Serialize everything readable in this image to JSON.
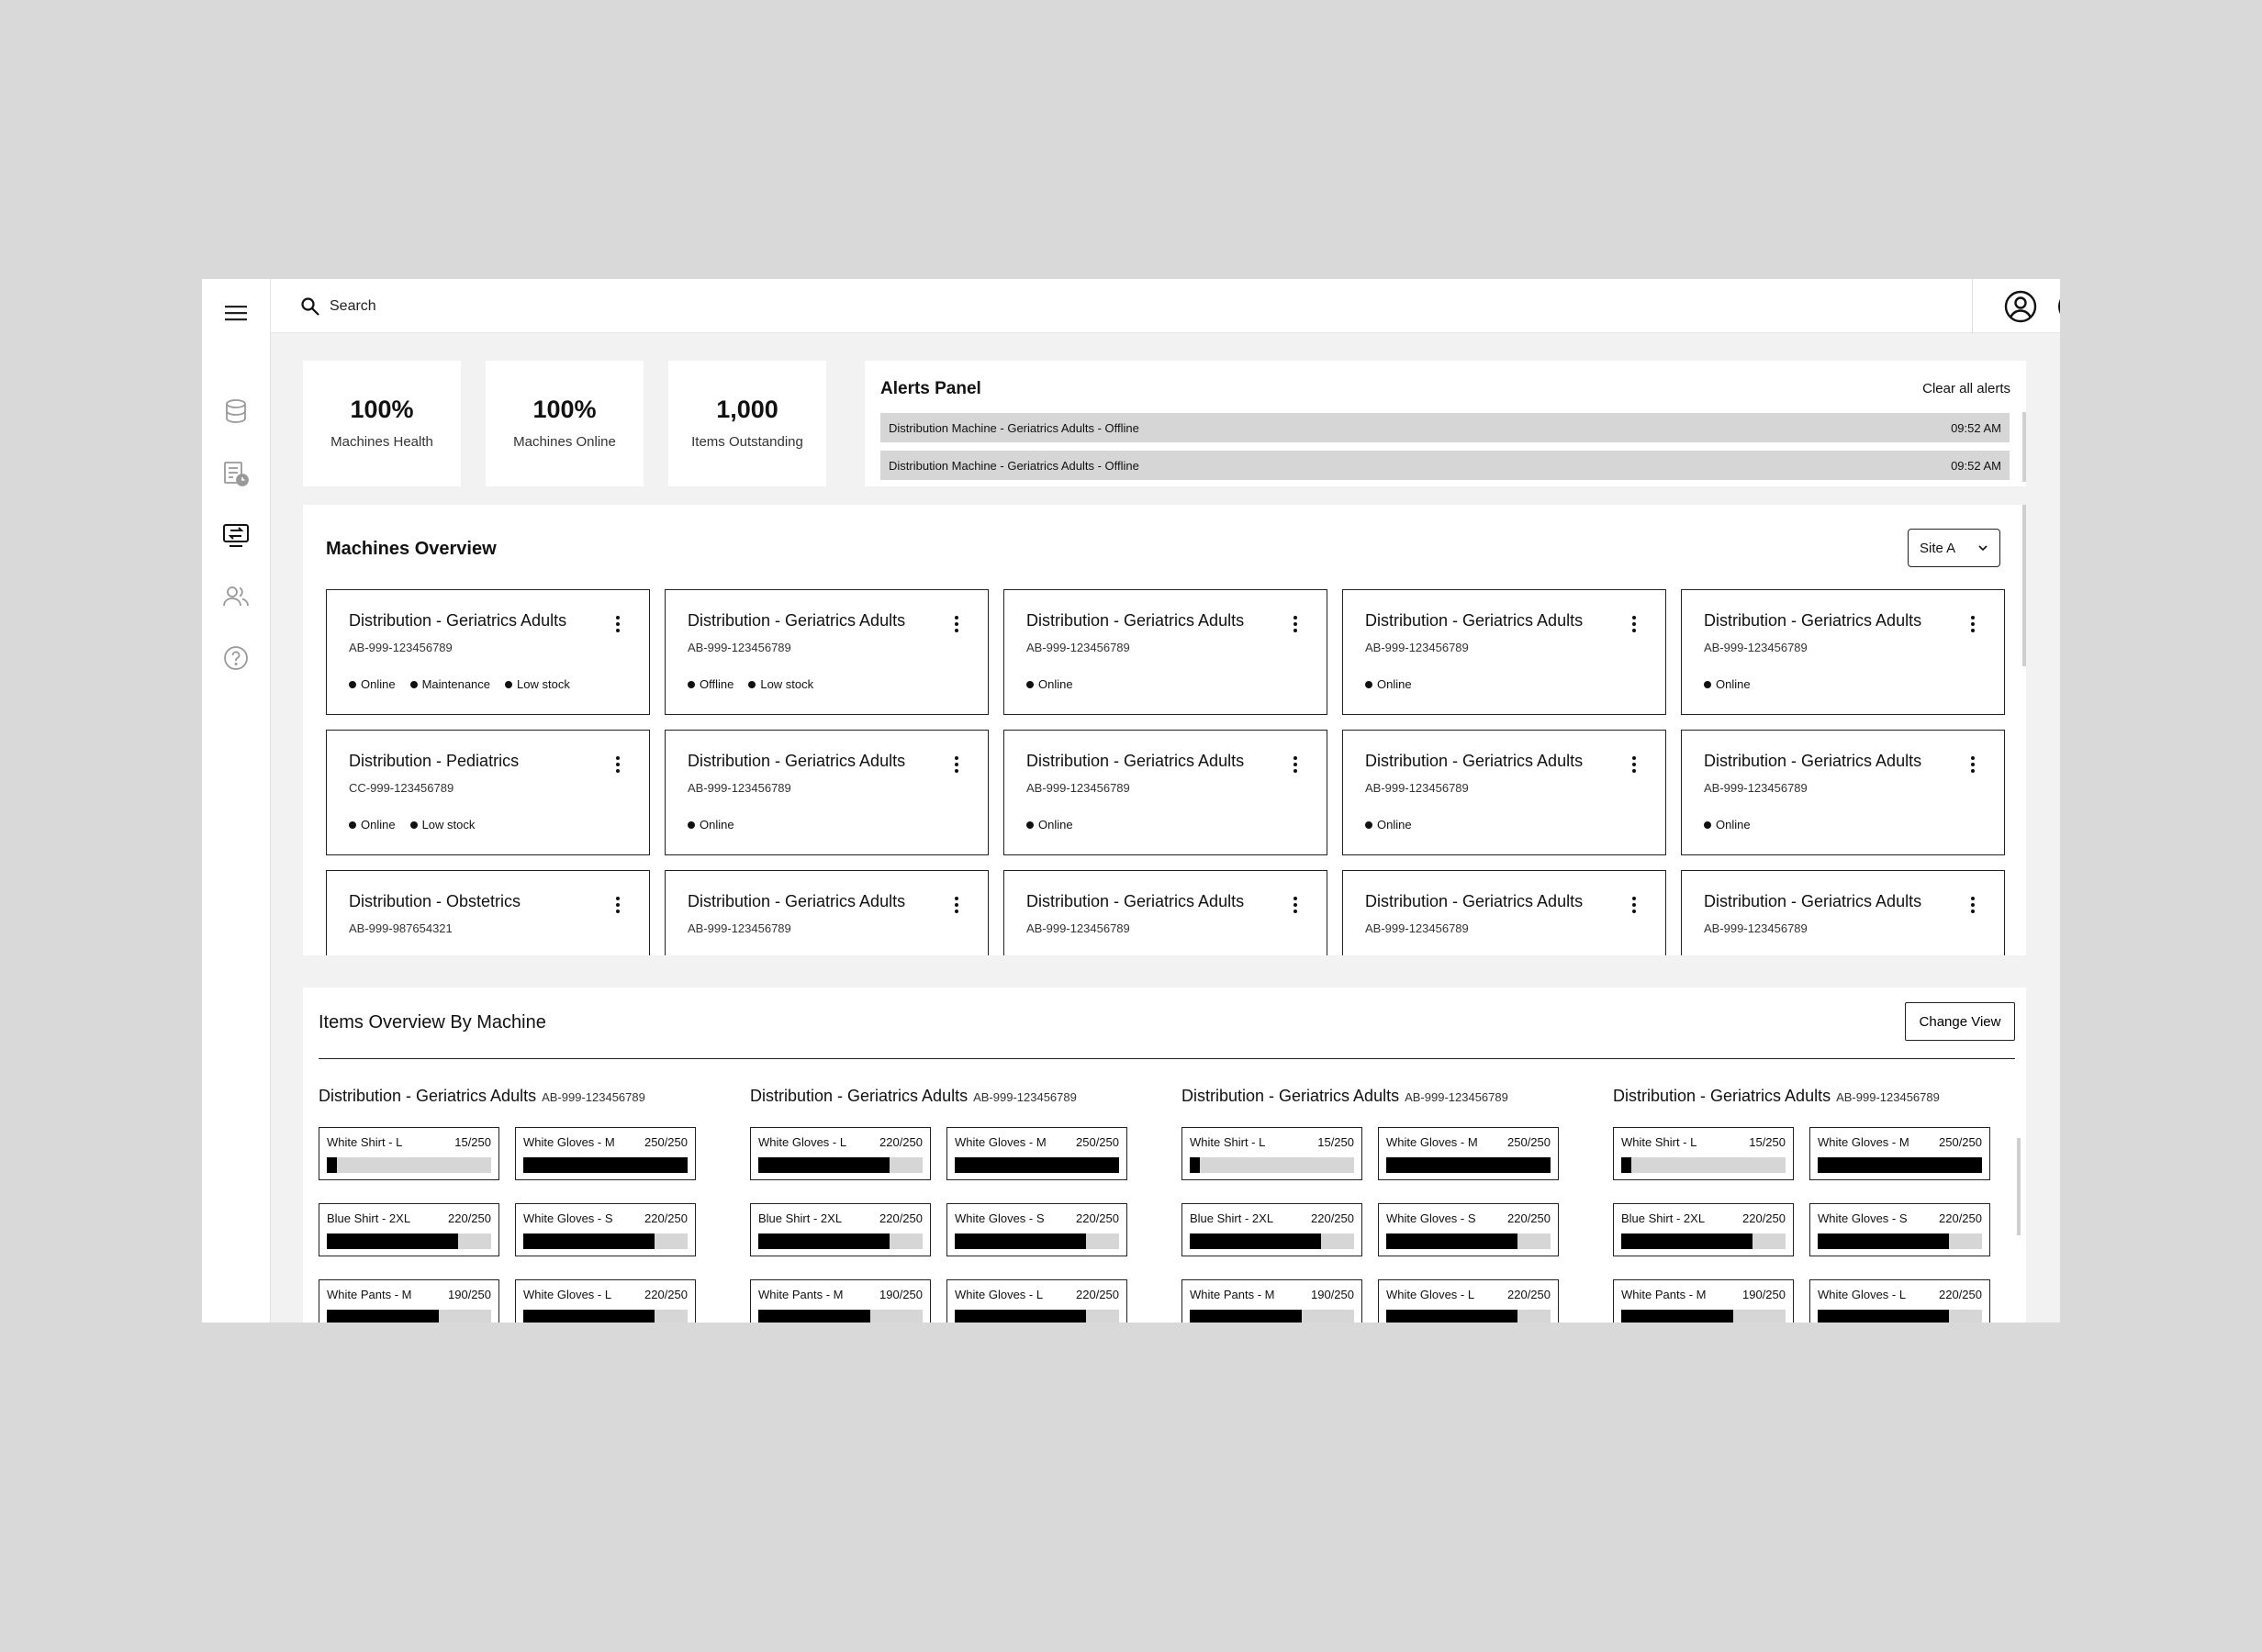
{
  "search": {
    "placeholder": "Search"
  },
  "stats": [
    {
      "value": "100%",
      "label": "Machines Health"
    },
    {
      "value": "100%",
      "label": "Machines Online"
    },
    {
      "value": "1,000",
      "label": "Items Outstanding"
    }
  ],
  "alerts": {
    "title": "Alerts Panel",
    "clear_label": "Clear all alerts",
    "rows": [
      {
        "text": "Distribution Machine  - Geriatrics Adults - Offline",
        "time": "09:52 AM"
      },
      {
        "text": "Distribution Machine  - Geriatrics Adults - Offline",
        "time": "09:52 AM"
      }
    ]
  },
  "machines": {
    "title": "Machines Overview",
    "site_select": "Site A",
    "cards": [
      {
        "name": "Distribution - Geriatrics Adults",
        "code": "AB-999-123456789",
        "statuses": [
          "Online",
          "Maintenance",
          "Low stock"
        ]
      },
      {
        "name": "Distribution - Geriatrics Adults",
        "code": "AB-999-123456789",
        "statuses": [
          "Offline",
          "Low stock"
        ]
      },
      {
        "name": "Distribution - Geriatrics Adults",
        "code": "AB-999-123456789",
        "statuses": [
          "Online"
        ]
      },
      {
        "name": "Distribution - Geriatrics Adults",
        "code": "AB-999-123456789",
        "statuses": [
          "Online"
        ]
      },
      {
        "name": "Distribution - Geriatrics Adults",
        "code": "AB-999-123456789",
        "statuses": [
          "Online"
        ]
      },
      {
        "name": "Distribution - Pediatrics",
        "code": "CC-999-123456789",
        "statuses": [
          "Online",
          "Low stock"
        ]
      },
      {
        "name": "Distribution - Geriatrics Adults",
        "code": "AB-999-123456789",
        "statuses": [
          "Online"
        ]
      },
      {
        "name": "Distribution - Geriatrics Adults",
        "code": "AB-999-123456789",
        "statuses": [
          "Online"
        ]
      },
      {
        "name": "Distribution - Geriatrics Adults",
        "code": "AB-999-123456789",
        "statuses": [
          "Online"
        ]
      },
      {
        "name": "Distribution - Geriatrics Adults",
        "code": "AB-999-123456789",
        "statuses": [
          "Online"
        ]
      },
      {
        "name": "Distribution - Obstetrics",
        "code": "AB-999-987654321",
        "statuses": []
      },
      {
        "name": "Distribution - Geriatrics Adults",
        "code": "AB-999-123456789",
        "statuses": []
      },
      {
        "name": "Distribution - Geriatrics Adults",
        "code": "AB-999-123456789",
        "statuses": []
      },
      {
        "name": "Distribution - Geriatrics Adults",
        "code": "AB-999-123456789",
        "statuses": []
      },
      {
        "name": "Distribution - Geriatrics Adults",
        "code": "AB-999-123456789",
        "statuses": []
      }
    ]
  },
  "items_overview": {
    "title": "Items Overview By Machine",
    "change_view_label": "Change View",
    "columns": [
      {
        "name": "Distribution - Geriatrics Adults",
        "code": "AB-999-123456789",
        "items": [
          {
            "name": "White Shirt - L",
            "qty": "15/250",
            "fill": 0.06
          },
          {
            "name": "White Gloves - M",
            "qty": "250/250",
            "fill": 1.0
          },
          {
            "name": "Blue Shirt - 2XL",
            "qty": "220/250",
            "fill": 0.8
          },
          {
            "name": "White Gloves - S",
            "qty": "220/250",
            "fill": 0.8
          },
          {
            "name": "White Pants - M",
            "qty": "190/250",
            "fill": 0.68
          },
          {
            "name": "White Gloves - L",
            "qty": "220/250",
            "fill": 0.8
          }
        ]
      },
      {
        "name": "Distribution - Geriatrics Adults",
        "code": "AB-999-123456789",
        "items": [
          {
            "name": "White Gloves - L",
            "qty": "220/250",
            "fill": 0.8
          },
          {
            "name": "White Gloves - M",
            "qty": "250/250",
            "fill": 1.0
          },
          {
            "name": "Blue Shirt - 2XL",
            "qty": "220/250",
            "fill": 0.8
          },
          {
            "name": "White Gloves - S",
            "qty": "220/250",
            "fill": 0.8
          },
          {
            "name": "White Pants - M",
            "qty": "190/250",
            "fill": 0.68
          },
          {
            "name": "White Gloves - L",
            "qty": "220/250",
            "fill": 0.8
          }
        ]
      },
      {
        "name": "Distribution - Geriatrics Adults",
        "code": "AB-999-123456789",
        "items": [
          {
            "name": "White Shirt - L",
            "qty": "15/250",
            "fill": 0.06
          },
          {
            "name": "White Gloves - M",
            "qty": "250/250",
            "fill": 1.0
          },
          {
            "name": "Blue Shirt - 2XL",
            "qty": "220/250",
            "fill": 0.8
          },
          {
            "name": "White Gloves - S",
            "qty": "220/250",
            "fill": 0.8
          },
          {
            "name": "White Pants - M",
            "qty": "190/250",
            "fill": 0.68
          },
          {
            "name": "White Gloves - L",
            "qty": "220/250",
            "fill": 0.8
          }
        ]
      },
      {
        "name": "Distribution - Geriatrics Adults",
        "code": "AB-999-123456789",
        "items": [
          {
            "name": "White Shirt - L",
            "qty": "15/250",
            "fill": 0.06
          },
          {
            "name": "White Gloves - M",
            "qty": "250/250",
            "fill": 1.0
          },
          {
            "name": "Blue Shirt - 2XL",
            "qty": "220/250",
            "fill": 0.8
          },
          {
            "name": "White Gloves - S",
            "qty": "220/250",
            "fill": 0.8
          },
          {
            "name": "White Pants - M",
            "qty": "190/250",
            "fill": 0.68
          },
          {
            "name": "White Gloves - L",
            "qty": "220/250",
            "fill": 0.8
          }
        ]
      }
    ]
  },
  "icons": {
    "sidebar": [
      "menu-icon",
      "database-icon",
      "report-clock-icon",
      "machine-transfer-icon",
      "users-icon",
      "help-icon"
    ],
    "top": [
      "search-icon",
      "user-account-icon",
      "notification-bell-icon"
    ]
  },
  "colors": {
    "background": "#d9d9d9",
    "panel": "#ffffff",
    "canvas": "#f2f2f2",
    "alert_row": "#d6d6d6",
    "bar_track": "#d6d6d6",
    "bar_fill": "#000000"
  }
}
